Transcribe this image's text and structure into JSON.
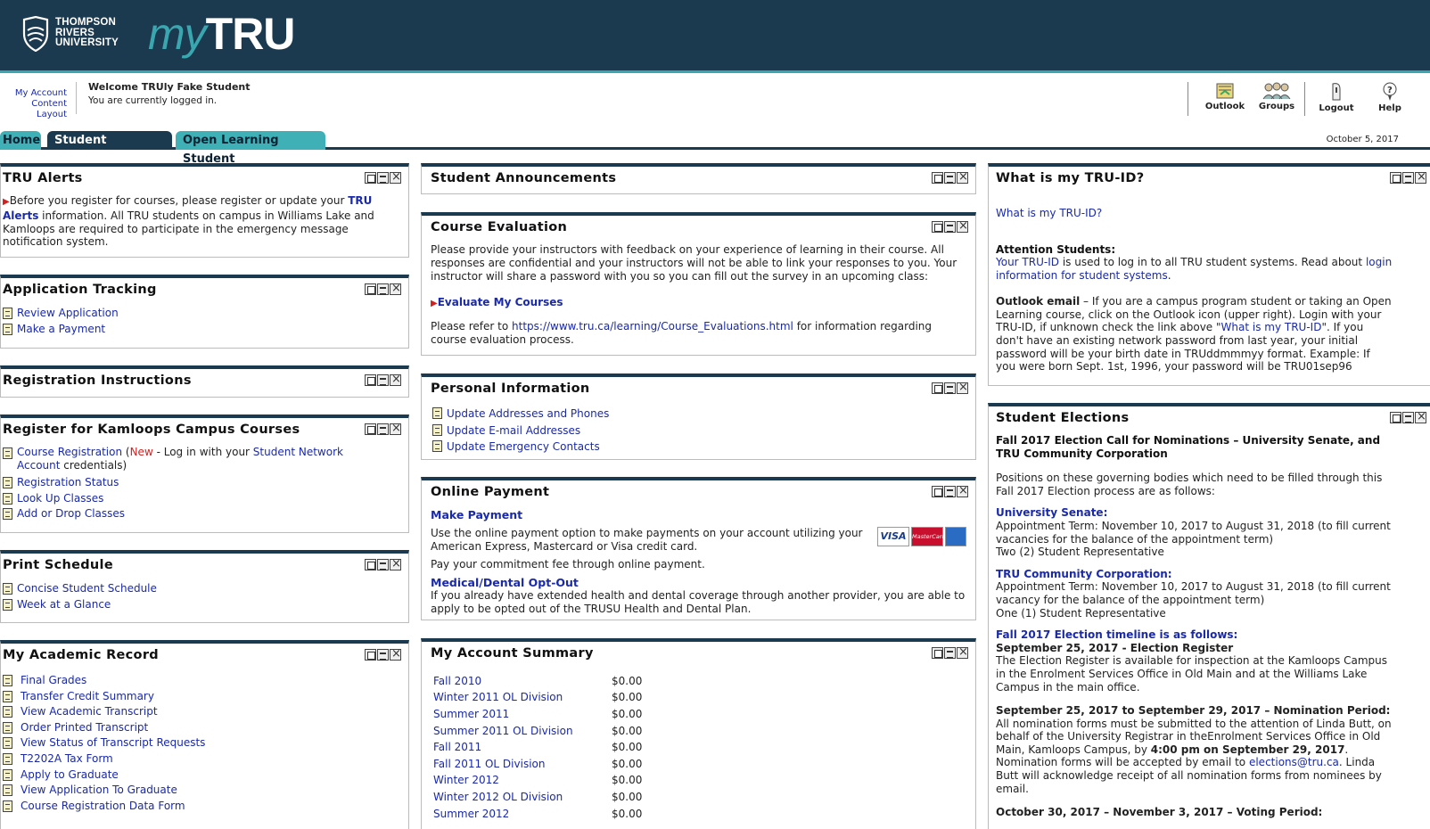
{
  "header": {
    "uni_line1": "THOMPSON",
    "uni_line2": "RIVERS",
    "uni_line3": "UNIVERSITY",
    "brand_my": "my",
    "brand_tru": "TRU"
  },
  "user": {
    "my_account": "My Account",
    "content_layout": "Content Layout",
    "welcome": "Welcome TRUly Fake Student",
    "status": "You are currently logged in."
  },
  "tools": {
    "outlook": "Outlook",
    "groups": "Groups",
    "logout": "Logout",
    "help": "Help"
  },
  "tabs": {
    "home": "Home",
    "student_resources": "Student Resources",
    "open_learning": "Open Learning Student"
  },
  "date": "October 5, 2017",
  "alerts": {
    "title": "TRU Alerts",
    "pre": "Before you register for courses, please register or update your ",
    "link": "TRU Alerts",
    "post": " information. All TRU students on campus in Williams Lake and Kamloops are required to participate in the emergency message notification system."
  },
  "app_tracking": {
    "title": "Application Tracking",
    "items": [
      "Review Application",
      "Make a Payment"
    ]
  },
  "reg_instructions": {
    "title": "Registration Instructions"
  },
  "register": {
    "title": "Register for Kamloops Campus Courses",
    "course_registration": "Course Registration",
    "open_paren": " (",
    "new": "New",
    "mid": " - Log in with your ",
    "network": "Student Network Account",
    "end": " credentials)",
    "items": [
      "Registration Status",
      "Look Up Classes",
      "Add or Drop Classes"
    ]
  },
  "print_schedule": {
    "title": "Print Schedule",
    "items": [
      "Concise Student Schedule",
      "Week at a Glance"
    ]
  },
  "academic": {
    "title": "My Academic Record",
    "items": [
      "Final Grades",
      "Transfer Credit Summary",
      "View Academic Transcript",
      "Order Printed Transcript",
      "View Status of Transcript Requests",
      "T2202A Tax Form",
      "Apply to Graduate",
      "View Application To Graduate",
      "Course Registration Data Form"
    ]
  },
  "announcements": {
    "title": "Student Announcements"
  },
  "course_eval": {
    "title": "Course Evaluation",
    "text": "Please provide your instructors with feedback on your experience of learning in their course. All responses are confidential and your instructors will not be able to link your responses to you. Your instructor will share a password with you so you can fill out the survey in an upcoming class:",
    "link": "Evaluate My Courses",
    "refer_pre": "Please refer to ",
    "refer_url": "https://www.tru.ca/learning/Course_Evaluations.html",
    "refer_post": " for information regarding course evaluation process."
  },
  "personal": {
    "title": "Personal Information",
    "items": [
      "Update Addresses and Phones",
      "Update E-mail Addresses",
      "Update Emergency Contacts"
    ]
  },
  "online_payment": {
    "title": "Online Payment",
    "make_payment": "Make Payment",
    "text1": "Use the online payment option to make payments on your account utilizing your American Express, Mastercard or Visa credit card.",
    "text2": "Pay your commitment fee through online payment.",
    "medical": "Medical/Dental Opt-Out",
    "text3": "If you already have extended health and dental coverage through another provider, you are able to apply to be opted out of the TRUSU Health and Dental Plan.",
    "visa": "VISA",
    "mc": "MasterCard"
  },
  "account_summary": {
    "title": "My Account Summary",
    "rows": [
      [
        "Fall 2010",
        "$0.00"
      ],
      [
        "Winter 2011 OL Division",
        "$0.00"
      ],
      [
        "Summer 2011",
        "$0.00"
      ],
      [
        "Summer 2011 OL Division",
        "$0.00"
      ],
      [
        "Fall 2011",
        "$0.00"
      ],
      [
        "Fall 2011 OL Division",
        "$0.00"
      ],
      [
        "Winter 2012",
        "$0.00"
      ],
      [
        "Winter 2012 OL Division",
        "$0.00"
      ],
      [
        "Summer 2012",
        "$0.00"
      ]
    ]
  },
  "truid": {
    "title": "What is my TRU-ID?",
    "link": "What is my TRU-ID?",
    "attn": "Attention Students:",
    "p1_link1": "Your TRU-ID",
    "p1_mid": " is used to log in to all TRU student systems. Read about ",
    "p1_link2": "login information for student systems",
    "p1_end": ".",
    "p2_bold": "Outlook email",
    "p2_a": " – If you are a campus program student or taking an Open Learning course, click on the Outlook icon (upper right). Login with your TRU-ID, if unknown check the link above \"",
    "p2_link": "What is my TRU-ID",
    "p2_b": "\". If you don't have an existing network password from last year, your initial password will be your birth date in TRUddmmmyy format. Example: If you were born Sept. 1st, 1996, your password will be TRU01sep96"
  },
  "elections": {
    "title": "Student Elections",
    "heading": "Fall 2017 Election Call for Nominations – University Senate, and TRU Community Corporation",
    "intro": "Positions on these governing bodies which need to be filled through this Fall 2017 Election process are as follows:",
    "senate_h": "University Senate:",
    "senate_t": "Appointment Term: November 10, 2017 to August 31, 2018 (to fill current vacancies for the balance of the appointment term)",
    "senate_n": "Two (2) Student Representative",
    "corp_h": "TRU Community Corporation:",
    "corp_t": "Appointment Term: November 10, 2017 to August 31, 2018 (to fill current vacancy for the balance of the appointment term)",
    "corp_n": "One (1) Student Representative",
    "timeline_h": "Fall 2017 Election timeline is as follows:",
    "reg_h": "September 25, 2017 - Election Register",
    "reg_t": "The Election Register is available for inspection at the Kamloops Campus in the Enrolment Services Office in Old Main and at the Williams Lake Campus in the main office.",
    "nom_h": "September 25, 2017 to September 29, 2017 – Nomination Period:",
    "nom_a": "All nomination forms must be submitted to the attention of Linda Butt, on behalf of the University Registrar in theEnrolment Services Office in Old Main, Kamloops Campus, by ",
    "nom_b": "4:00 pm on September 29, 2017",
    "nom_c": ".",
    "nom_d": "Nomination forms will be accepted by email to ",
    "nom_email": "elections@tru.ca",
    "nom_e": ". Linda Butt will acknowledge receipt of all nomination forms from nominees by email.",
    "vote_h": "October 30, 2017 – November 3, 2017 – Voting Period:"
  }
}
